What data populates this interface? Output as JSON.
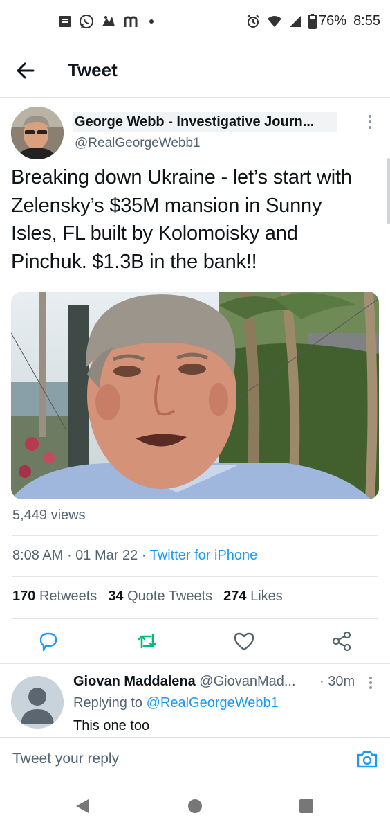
{
  "status_bar": {
    "battery": "76%",
    "time": "8:55",
    "left_icons": [
      "message-icon",
      "whatsapp-icon",
      "app-icon",
      "m-icon",
      "dot-icon"
    ],
    "right_icons": [
      "alarm-icon",
      "wifi-icon",
      "signal-icon",
      "battery-icon"
    ]
  },
  "header": {
    "title": "Tweet",
    "back_icon": "arrow-left-icon"
  },
  "tweet": {
    "author_name": "George Webb - Investigative Journ...",
    "author_handle": "@RealGeorgeWebb1",
    "text": "Breaking down Ukraine - let’s start with Zelensky’s $35M mansion in Sunny Isles, FL built by Kolomoisky and Pinchuk. $1.3B in the bank!!",
    "views": "5,449 views",
    "time": "8:08 AM",
    "date": "01 Mar 22",
    "separator": " · ",
    "source": "Twitter for iPhone",
    "stats": {
      "retweets_count": "170",
      "retweets_label": "Retweets",
      "quotes_count": "34",
      "quotes_label": "Quote Tweets",
      "likes_count": "274",
      "likes_label": "Likes"
    },
    "actions": [
      "reply-icon",
      "retweet-icon",
      "like-icon",
      "share-icon"
    ]
  },
  "reply": {
    "name": "Giovan Maddalena",
    "handle": "@GiovanMad...",
    "time": "· 30m",
    "replying_label": "Replying to",
    "replying_to": "@RealGeorgeWebb1",
    "text": "This one too"
  },
  "compose": {
    "placeholder": "Tweet your reply"
  },
  "colors": {
    "accent": "#1d9bf0",
    "retweet": "#00ba7c",
    "secondary_text": "#536471",
    "text": "#0f1419"
  }
}
